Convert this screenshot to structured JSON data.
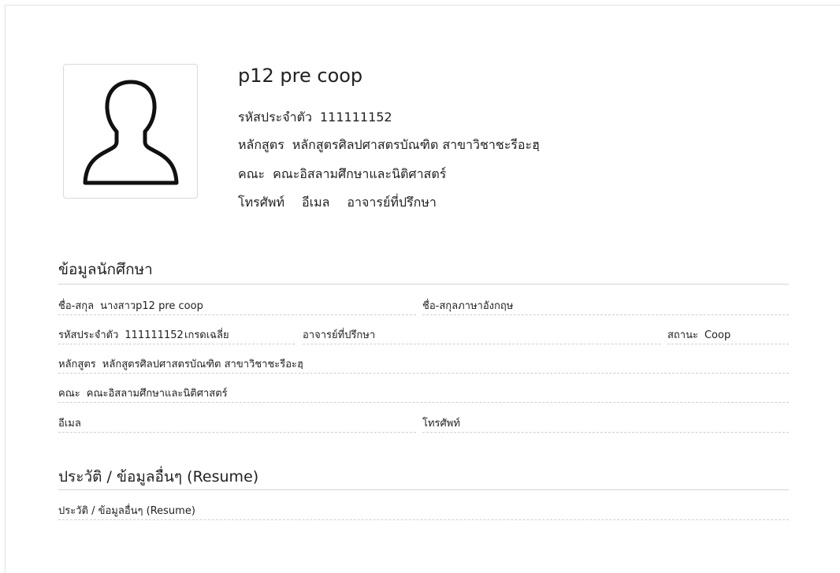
{
  "profile": {
    "name": "p12 pre coop",
    "student_id_label": "รหัสประจำตัว",
    "student_id": "111111152",
    "program_label": "หลักสูตร",
    "program": "หลักสูตรศิลปศาสตรบัณฑิต สาขาวิชาชะรีอะฮฺ",
    "faculty_label": "คณะ",
    "faculty": "คณะอิสลามศึกษาและนิติศาสตร์",
    "phone_label": "โทรศัพท์",
    "email_label": "อีเมล",
    "advisor_label": "อาจารย์ที่ปรึกษา",
    "avatar_icon": "person-silhouette-icon"
  },
  "student_info": {
    "title": "ข้อมูลนักศึกษา",
    "fullname_label": "ชื่อ-สกุล",
    "fullname": "นางสาวp12 pre coop",
    "fullname_en_label": "ชื่อ-สกุลภาษาอังกฤษ",
    "fullname_en": "",
    "student_id_label": "รหัสประจำตัว",
    "student_id": "111111152",
    "gpa_label": "เกรดเฉลี่ย",
    "gpa": "",
    "advisor_label": "อาจารย์ที่ปรึกษา",
    "advisor": "",
    "status_label": "สถานะ",
    "status": "Coop",
    "program_label": "หลักสูตร",
    "program": "หลักสูตรศิลปศาสตรบัณฑิต สาขาวิชาชะรีอะฮฺ",
    "faculty_label": "คณะ",
    "faculty": "คณะอิสลามศึกษาและนิติศาสตร์",
    "email_label": "อีเมล",
    "email": "",
    "phone_label": "โทรศัพท์",
    "phone": ""
  },
  "resume": {
    "title": "ประวัติ / ข้อมูลอื่นๆ (Resume)",
    "label": "ประวัติ / ข้อมูลอื่นๆ (Resume)",
    "value": ""
  }
}
